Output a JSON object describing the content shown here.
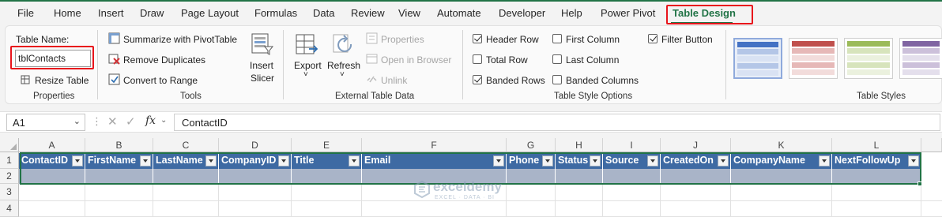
{
  "menu": {
    "tabs": [
      "File",
      "Home",
      "Insert",
      "Draw",
      "Page Layout",
      "Formulas",
      "Data",
      "Review",
      "View",
      "Automate",
      "Developer",
      "Help",
      "Power Pivot",
      "Table Design"
    ]
  },
  "ribbon": {
    "properties": {
      "table_name_label": "Table Name:",
      "table_name_value": "tblContacts",
      "resize_label": "Resize Table",
      "group_label": "Properties"
    },
    "tools": {
      "summarize": "Summarize with PivotTable",
      "remove_dup": "Remove Duplicates",
      "convert": "Convert to Range",
      "insert_slicer_1": "Insert",
      "insert_slicer_2": "Slicer",
      "group_label": "Tools"
    },
    "external": {
      "export": "Export",
      "refresh": "Refresh",
      "properties": "Properties",
      "open_browser": "Open in Browser",
      "unlink": "Unlink",
      "group_label": "External Table Data"
    },
    "style_options": {
      "header_row": "Header Row",
      "total_row": "Total Row",
      "banded_rows": "Banded Rows",
      "first_column": "First Column",
      "last_column": "Last Column",
      "banded_columns": "Banded Columns",
      "filter_button": "Filter Button",
      "header_row_checked": true,
      "total_row_checked": false,
      "banded_rows_checked": true,
      "first_column_checked": false,
      "last_column_checked": false,
      "banded_columns_checked": false,
      "filter_button_checked": true,
      "group_label": "Table Style Options"
    },
    "table_styles": {
      "group_label": "Table Styles",
      "swatch_colors": [
        "#4472c4",
        "#c0504d",
        "#9bbb59",
        "#8064a2"
      ]
    }
  },
  "formula_bar": {
    "name_box": "A1",
    "fx": "fx",
    "content": "ContactID"
  },
  "sheet": {
    "columns": [
      "A",
      "B",
      "C",
      "D",
      "E",
      "F",
      "G",
      "H",
      "I",
      "J",
      "K",
      "L"
    ],
    "rows": [
      "1",
      "2",
      "3",
      "4"
    ],
    "headers": [
      "ContactID",
      "FirstName",
      "LastName",
      "CompanyID",
      "Title",
      "Email",
      "Phone",
      "Status",
      "Source",
      "CreatedOn",
      "CompanyName",
      "NextFollowUp"
    ]
  },
  "watermark": {
    "name": "exceldemy",
    "tagline": "EXCEL · DATA · BI"
  }
}
